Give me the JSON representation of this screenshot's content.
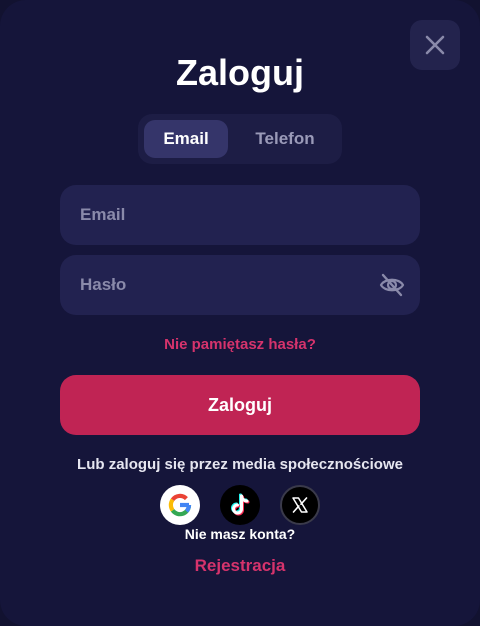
{
  "modal": {
    "title": "Zaloguj",
    "close_icon": "close-icon"
  },
  "tabs": [
    {
      "label": "Email",
      "active": true
    },
    {
      "label": "Telefon",
      "active": false
    }
  ],
  "form": {
    "email": {
      "placeholder": "Email",
      "value": ""
    },
    "password": {
      "placeholder": "Hasło",
      "value": "",
      "toggle_icon": "eye-off-icon"
    },
    "forgot_label": "Nie pamiętasz hasła?",
    "submit_label": "Zaloguj"
  },
  "social": {
    "caption": "Lub zaloguj się przez media społecznościowe",
    "providers": [
      {
        "name": "Google",
        "icon": "google-icon"
      },
      {
        "name": "TikTok",
        "icon": "tiktok-icon"
      },
      {
        "name": "X",
        "icon": "x-icon"
      }
    ]
  },
  "footer": {
    "no_account": "Nie masz konta?",
    "register_label": "Rejestracja"
  },
  "colors": {
    "background": "#15153a",
    "field": "#222250",
    "accent": "#c02454",
    "link": "#d6336c"
  }
}
